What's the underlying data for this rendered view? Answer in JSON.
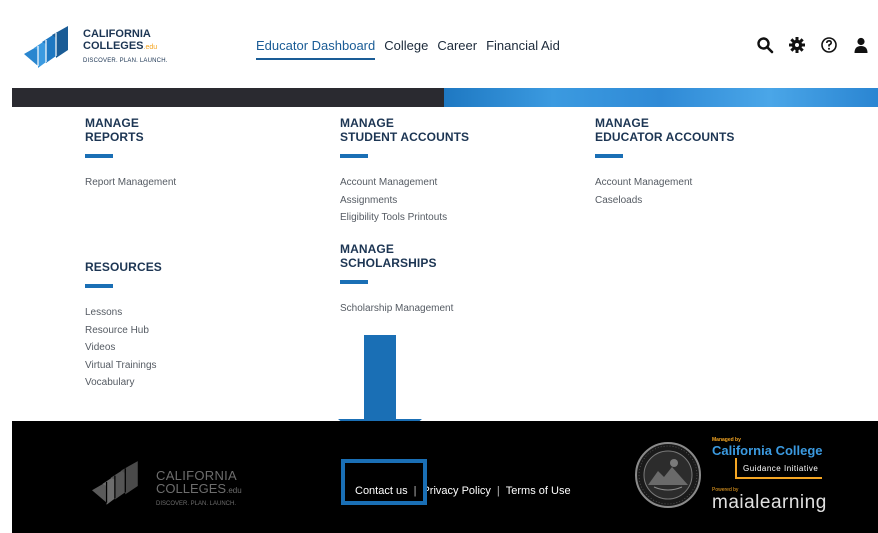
{
  "header": {
    "logo": {
      "line1": "CALIFORNIA",
      "line2": "COLLEGES",
      "line2_suffix": ".edu",
      "tagline": "DISCOVER. PLAN. LAUNCH."
    },
    "nav": [
      {
        "label": "Educator Dashboard",
        "active": true
      },
      {
        "label": "College",
        "active": false
      },
      {
        "label": "Career",
        "active": false
      },
      {
        "label": "Financial Aid",
        "active": false
      }
    ],
    "icons": [
      "search-icon",
      "gear-icon",
      "help-icon",
      "user-icon"
    ]
  },
  "sections": {
    "manage_reports": {
      "title_line1": "MANAGE",
      "title_line2": "REPORTS",
      "links": [
        "Report Management"
      ]
    },
    "manage_student_accounts": {
      "title_line1": "MANAGE",
      "title_line2": "STUDENT ACCOUNTS",
      "links": [
        "Account Management",
        "Assignments",
        "Eligibility Tools Printouts"
      ]
    },
    "manage_educator_accounts": {
      "title_line1": "MANAGE",
      "title_line2": "EDUCATOR ACCOUNTS",
      "links": [
        "Account Management",
        "Caseloads"
      ]
    },
    "resources": {
      "title_line2": "RESOURCES",
      "links": [
        "Lessons",
        "Resource Hub",
        "Videos",
        "Virtual Trainings",
        "Vocabulary"
      ]
    },
    "manage_scholarships": {
      "title_line1": "MANAGE",
      "title_line2": "SCHOLARSHIPS",
      "links": [
        "Scholarship Management"
      ]
    }
  },
  "annotation": {
    "arrow_color": "#1a6fb5",
    "highlight_color": "#1a6fb5"
  },
  "footer": {
    "logo": {
      "line1": "CALIFORNIA",
      "line2": "COLLEGES",
      "line2_suffix": ".edu",
      "tagline": "DISCOVER. PLAN. LAUNCH."
    },
    "links": [
      "Contact us",
      "Privacy Policy",
      "Terms of Use"
    ],
    "managed_by": {
      "label": "Managed by",
      "org": "California College",
      "sub": "Guidance Initiative",
      "powered_label": "Powered by",
      "powered_brand": "maialearning"
    }
  },
  "colors": {
    "brand_navy": "#1c3553",
    "brand_blue": "#1a6fb5",
    "accent_orange": "#f5a623",
    "footer_bg": "#000000"
  }
}
